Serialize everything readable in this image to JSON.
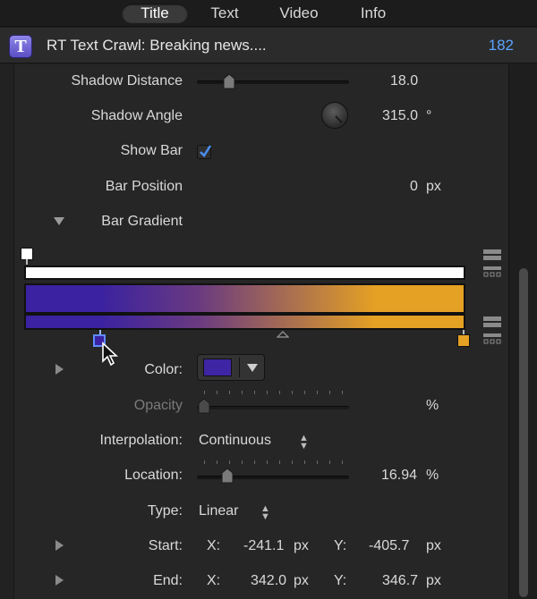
{
  "tabs": [
    {
      "label": "Title",
      "active": true
    },
    {
      "label": "Text",
      "active": false
    },
    {
      "label": "Video",
      "active": false
    },
    {
      "label": "Info",
      "active": false
    }
  ],
  "header": {
    "icon_letter": "T",
    "clip_name": "RT Text Crawl: Breaking news....",
    "clip_number": "182"
  },
  "shadow_distance": {
    "label": "Shadow Distance",
    "value": "18.0"
  },
  "shadow_angle": {
    "label": "Shadow Angle",
    "value": "315.0",
    "unit": "°"
  },
  "show_bar": {
    "label": "Show Bar",
    "checked": true
  },
  "bar_position": {
    "label": "Bar Position",
    "value": "0",
    "unit": "px"
  },
  "bar_gradient": {
    "label": "Bar Gradient",
    "start_color": "#3a22a0",
    "end_color": "#e5a123",
    "selected_stop_location": 0.1694
  },
  "color": {
    "label": "Color:",
    "swatch": "#3d25a3"
  },
  "opacity": {
    "label": "Opacity",
    "unit": "%"
  },
  "interpolation": {
    "label": "Interpolation:",
    "value": "Continuous"
  },
  "location": {
    "label": "Location:",
    "value": "16.94",
    "unit": "%"
  },
  "type": {
    "label": "Type:",
    "value": "Linear"
  },
  "start": {
    "label": "Start:",
    "x_label": "X:",
    "x": "-241.1",
    "y_label": "Y:",
    "y": "-405.7",
    "unit": "px"
  },
  "end": {
    "label": "End:",
    "x_label": "X:",
    "x": "342.0",
    "y_label": "Y:",
    "y": "346.7",
    "unit": "px"
  },
  "icons": [
    "title-t-icon",
    "disclosure-triangle-icon",
    "checkmark-icon",
    "mouse-cursor-icon",
    "dial-icon",
    "gradient-stop-icon"
  ]
}
